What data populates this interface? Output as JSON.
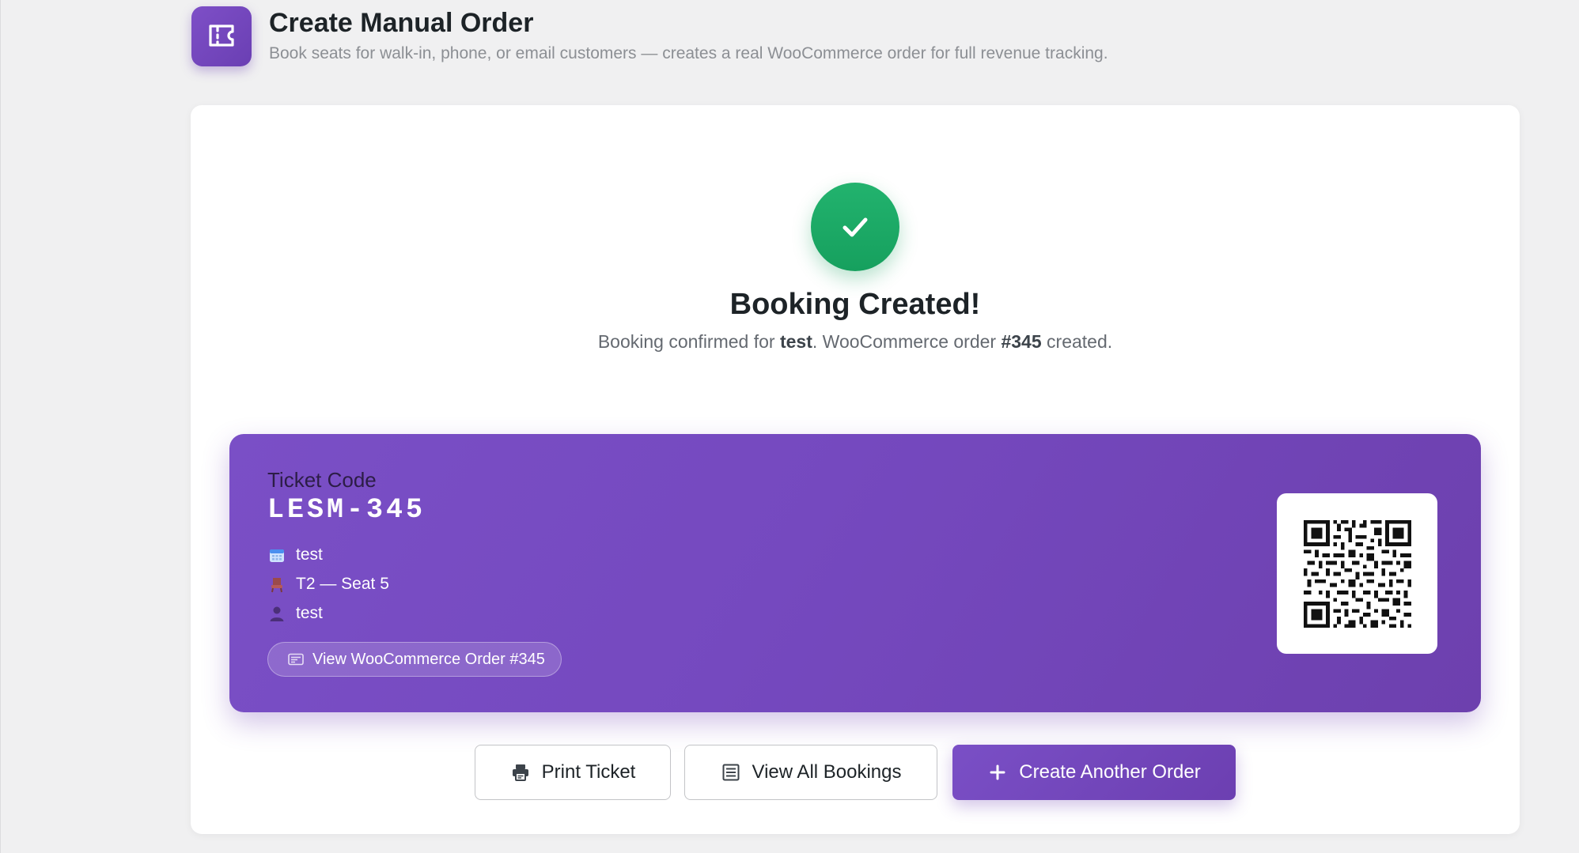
{
  "header": {
    "title": "Create Manual Order",
    "subtitle": "Book seats for walk-in, phone, or email customers — creates a real WooCommerce order for full revenue tracking.",
    "icon": "ticket-icon"
  },
  "success": {
    "icon": "checkmark-icon",
    "title": "Booking Created!",
    "message_prefix": "Booking confirmed for ",
    "customer": "test",
    "message_middle": ". WooCommerce order ",
    "order_ref": "#345",
    "message_suffix": " created."
  },
  "ticket": {
    "label": "Ticket Code",
    "code": "LESM-345",
    "details": [
      {
        "icon": "calendar-icon",
        "text": "test"
      },
      {
        "icon": "seat-icon",
        "text": "T2 — Seat 5"
      },
      {
        "icon": "person-icon",
        "text": "test"
      }
    ],
    "order_link": {
      "icon": "receipt-icon",
      "label": "View WooCommerce Order #345"
    },
    "qr_icon": "qr-code-icon"
  },
  "actions": {
    "print": {
      "icon": "printer-icon",
      "label": "Print Ticket"
    },
    "view_all": {
      "icon": "list-icon",
      "label": "View All Bookings"
    },
    "create_another": {
      "icon": "plus-icon",
      "label": "Create Another Order"
    }
  },
  "colors": {
    "accent": "#7549bf",
    "success": "#16a05e",
    "background": "#f0f0f1"
  }
}
